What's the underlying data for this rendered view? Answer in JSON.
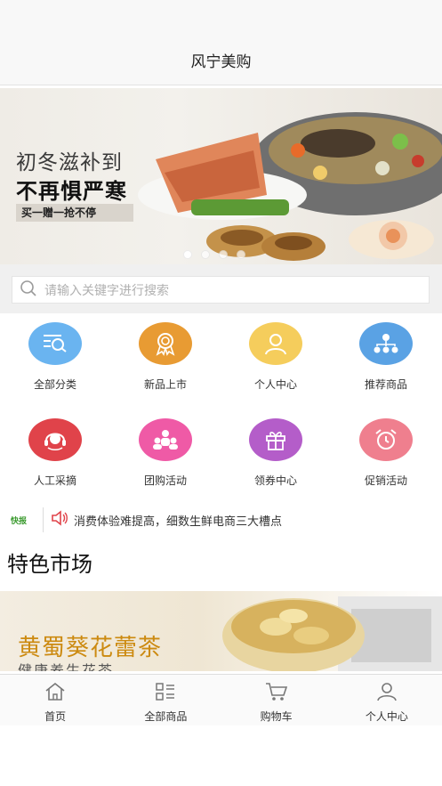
{
  "navbar": {
    "title": "风宁美购"
  },
  "banner": {
    "headline1": "初冬滋补到",
    "headline2": "不再惧严寒",
    "tag": "买一赠一抢不停",
    "dot_count": 4,
    "active_dot": 0
  },
  "search": {
    "placeholder": "请输入关键字进行搜索"
  },
  "categories": [
    {
      "label": "全部分类",
      "icon": "list-search-icon",
      "color": "#6ab4f0"
    },
    {
      "label": "新品上市",
      "icon": "award-icon",
      "color": "#e89b33"
    },
    {
      "label": "个人中心",
      "icon": "user-icon",
      "color": "#f5cd5c"
    },
    {
      "label": "推荐商品",
      "icon": "network-icon",
      "color": "#5aa2e4"
    },
    {
      "label": "人工采摘",
      "icon": "headset-icon",
      "color": "#e0434a"
    },
    {
      "label": "团购活动",
      "icon": "group-icon",
      "color": "#ef5aa6"
    },
    {
      "label": "领券中心",
      "icon": "gift-icon",
      "color": "#b45dc9"
    },
    {
      "label": "促销活动",
      "icon": "alarm-clock-icon",
      "color": "#ef7f8e"
    }
  ],
  "notice": {
    "badge": "快报",
    "text": "消费体验难提高，细数生鲜电商三大槽点"
  },
  "section": {
    "title": "特色市场"
  },
  "feature": {
    "title": "黄蜀葵花蕾茶",
    "subtitle": "健康养生花茶"
  },
  "tabbar": [
    {
      "label": "首页",
      "icon": "home-icon"
    },
    {
      "label": "全部商品",
      "icon": "grid-list-icon"
    },
    {
      "label": "购物车",
      "icon": "cart-icon"
    },
    {
      "label": "个人中心",
      "icon": "user-icon"
    }
  ]
}
